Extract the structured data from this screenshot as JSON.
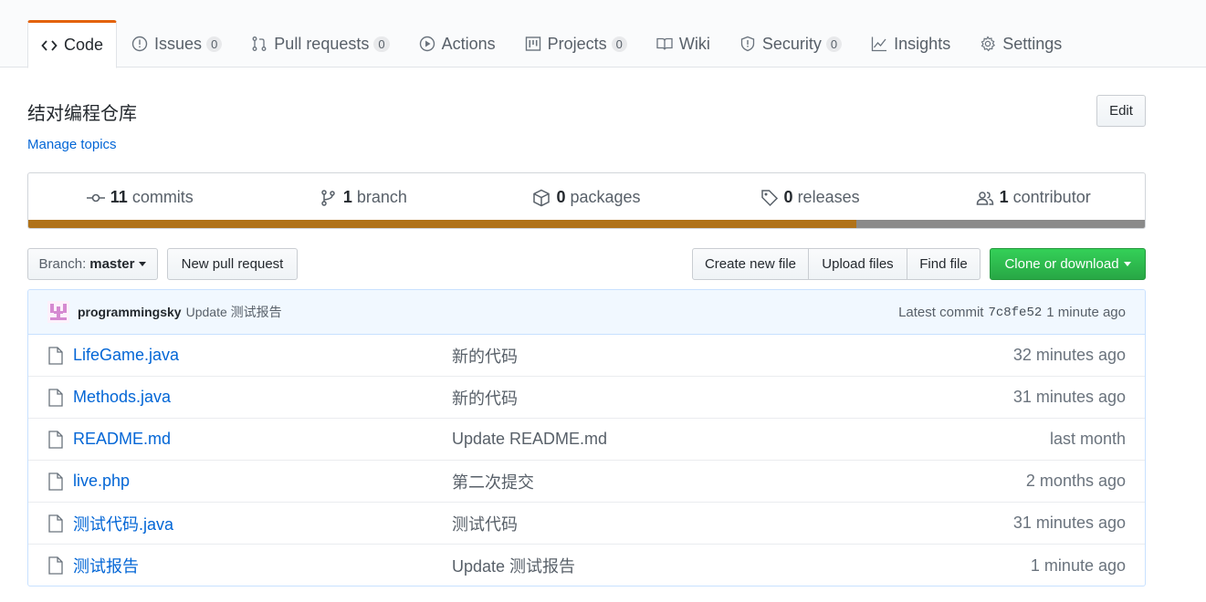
{
  "tabs": [
    {
      "label": "Code",
      "icon": "code-icon",
      "count": null,
      "selected": true
    },
    {
      "label": "Issues",
      "icon": "issue-icon",
      "count": "0"
    },
    {
      "label": "Pull requests",
      "icon": "pull-request-icon",
      "count": "0"
    },
    {
      "label": "Actions",
      "icon": "play-icon",
      "count": null
    },
    {
      "label": "Projects",
      "icon": "project-icon",
      "count": "0"
    },
    {
      "label": "Wiki",
      "icon": "book-icon",
      "count": null
    },
    {
      "label": "Security",
      "icon": "shield-icon",
      "count": "0"
    },
    {
      "label": "Insights",
      "icon": "graph-icon",
      "count": null
    },
    {
      "label": "Settings",
      "icon": "gear-icon",
      "count": null
    }
  ],
  "repo": {
    "description": "结对编程仓库",
    "manage_topics": "Manage topics",
    "edit_label": "Edit"
  },
  "summary": {
    "commits": {
      "count": "11",
      "label": "commits"
    },
    "branches": {
      "count": "1",
      "label": "branch"
    },
    "packages": {
      "count": "0",
      "label": "packages"
    },
    "releases": {
      "count": "0",
      "label": "releases"
    },
    "contributors": {
      "count": "1",
      "label": "contributor"
    },
    "languages": [
      {
        "color": "#b07219",
        "fraction": 0.742
      },
      {
        "color": "#8a8a8a",
        "fraction": 0.258
      }
    ]
  },
  "file_nav": {
    "branch_label": "Branch:",
    "branch_value": "master",
    "new_pr": "New pull request",
    "create_file": "Create new file",
    "upload_files": "Upload files",
    "find_file": "Find file",
    "clone": "Clone or download"
  },
  "latest_commit": {
    "author": "programmingsky",
    "message": "Update 测试报告",
    "prefix": "Latest commit",
    "sha": "7c8fe52",
    "age": "1 minute ago"
  },
  "files": [
    {
      "name": "LifeGame.java",
      "message": "新的代码",
      "age": "32 minutes ago"
    },
    {
      "name": "Methods.java",
      "message": "新的代码",
      "age": "31 minutes ago"
    },
    {
      "name": "README.md",
      "message": "Update README.md",
      "age": "last month"
    },
    {
      "name": "live.php",
      "message": "第二次提交",
      "age": "2 months ago"
    },
    {
      "name": "测试代码.java",
      "message": "测试代码",
      "age": "31 minutes ago"
    },
    {
      "name": "测试报告",
      "message": "Update 测试报告",
      "age": "1 minute ago"
    }
  ],
  "colors": {
    "accent_tab": "#e36209",
    "link": "#0366d6",
    "clone_green": "#28a745"
  }
}
